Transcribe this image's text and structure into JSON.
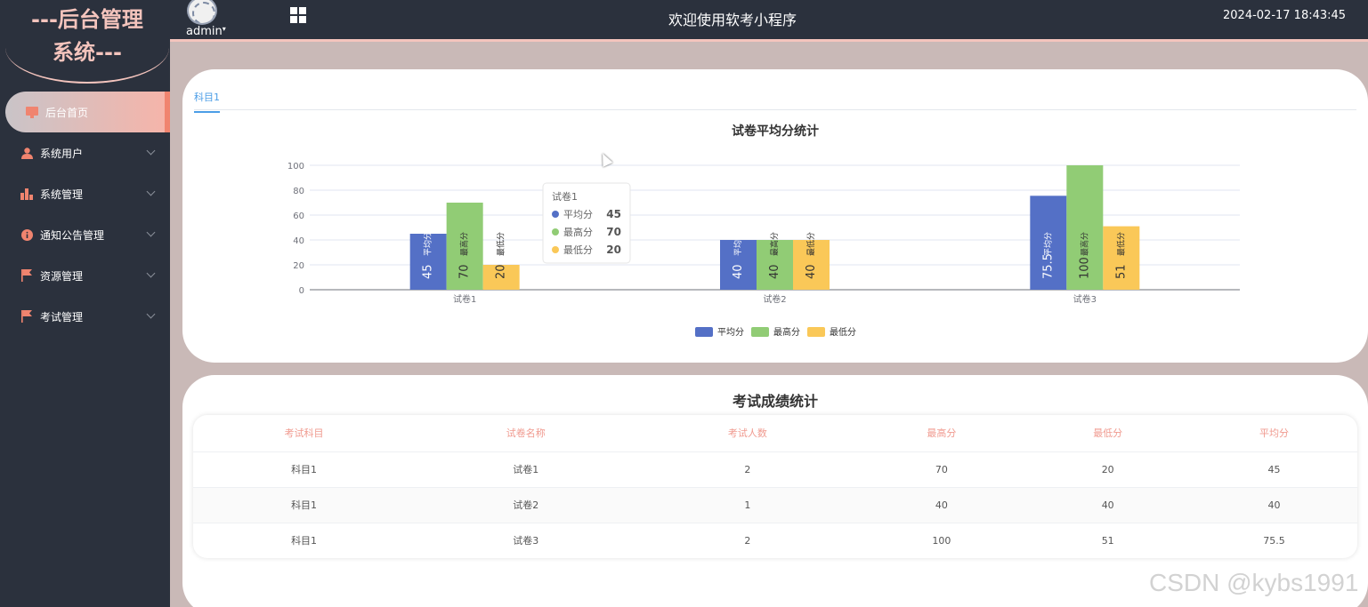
{
  "logo": {
    "line1": "---后台管理",
    "line2": "系统---"
  },
  "sidebar": {
    "items": [
      {
        "label": "后台首页",
        "icon": "monitor-icon",
        "active": true
      },
      {
        "label": "系统用户",
        "icon": "user-icon"
      },
      {
        "label": "系统管理",
        "icon": "bar-chart-icon"
      },
      {
        "label": "通知公告管理",
        "icon": "info-icon"
      },
      {
        "label": "资源管理",
        "icon": "flag-icon"
      },
      {
        "label": "考试管理",
        "icon": "flag-icon"
      }
    ]
  },
  "header": {
    "user": "admin",
    "title": "欢迎使用软考小程序",
    "datetime": "2024-02-17 18:43:45"
  },
  "tabs": {
    "active": "科目1"
  },
  "chart_data": {
    "type": "bar",
    "title": "试卷平均分统计",
    "categories": [
      "试卷1",
      "试卷2",
      "试卷3"
    ],
    "series": [
      {
        "name": "平均分",
        "values": [
          45,
          40,
          75.5
        ],
        "color": "#5470c6"
      },
      {
        "name": "最高分",
        "values": [
          70,
          40,
          100
        ],
        "color": "#91cc75"
      },
      {
        "name": "最低分",
        "values": [
          20,
          40,
          51
        ],
        "color": "#fac858"
      }
    ],
    "ylim": [
      0,
      100
    ],
    "yticks": [
      0,
      20,
      40,
      60,
      80,
      100
    ],
    "legend": "bottom-center",
    "grid": true,
    "tooltip": {
      "category": "试卷1",
      "rows": [
        {
          "name": "平均分",
          "value": "45"
        },
        {
          "name": "最高分",
          "value": "70"
        },
        {
          "name": "最低分",
          "value": "20"
        }
      ]
    }
  },
  "table": {
    "title": "考试成绩统计",
    "columns": [
      "考试科目",
      "试卷名称",
      "考试人数",
      "最高分",
      "最低分",
      "平均分"
    ],
    "rows": [
      [
        "科目1",
        "试卷1",
        "2",
        "70",
        "20",
        "45"
      ],
      [
        "科目1",
        "试卷2",
        "1",
        "40",
        "40",
        "40"
      ],
      [
        "科目1",
        "试卷3",
        "2",
        "100",
        "51",
        "75.5"
      ]
    ]
  },
  "watermark": "CSDN @kybs1991"
}
